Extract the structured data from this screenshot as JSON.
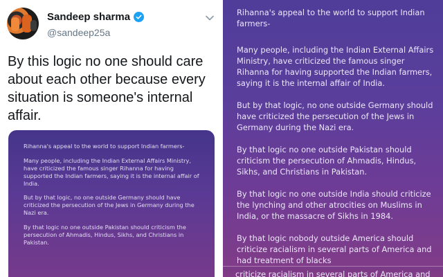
{
  "tweet": {
    "author_name": "Sandeep sharma",
    "author_handle": "@sandeep25a",
    "body": "By this logic no one should care about each other because every situation is someone's internal affair.",
    "embed_paragraphs": [
      "Rihanna's appeal to the world to support Indian farmers-",
      "Many people, including the Indian External Affairs Ministry,  have criticized the famous singer Rihanna for having supported the Indian farmers, saying it is the internal affair of India.",
      "But by that logic, no one outside Germany should have criticized the persecution of the Jews in Germany during the Nazi era.",
      "By that logic no one outside Pakistan should criticism the persecution of Ahmadis, Hindus, Sikhs, and Christians in Pakistan."
    ]
  },
  "card": {
    "paragraphs": [
      "Rihanna's appeal to the world to support Indian farmers-",
      "Many people, including the Indian External Affairs Ministry,  have criticized the famous singer Rihanna for having supported the Indian farmers, saying it is the internal affair of India.",
      "But by that logic, no one outside Germany should have criticized the persecution of the Jews in Germany during the Nazi era.",
      "By that logic no one outside Pakistan should criticism the persecution of Ahmadis, Hindus, Sikhs, and Christians in Pakistan.",
      "By that logic no one outside India should criticize the lynching and other atrocities on Muslims in India, or the massacre of Sikhs in 1984.",
      "By that logic nobody outside America should criticize racialism in several parts of America and had treatment of blacks"
    ],
    "overlay_line": "criticize racialism in several parts of America and"
  },
  "colors": {
    "verified": "#1da1f2",
    "card_top": "#4f3d99",
    "card_bottom": "#823c86"
  },
  "icons": [
    "verified-badge-icon",
    "chevron-down-icon"
  ]
}
